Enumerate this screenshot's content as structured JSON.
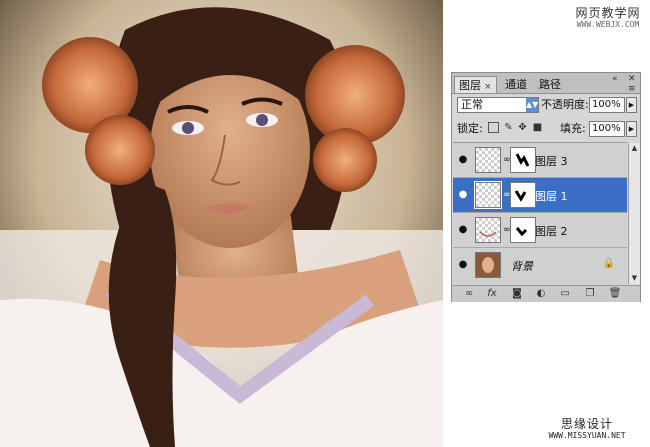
{
  "watermark_top": {
    "cn": "网页教学网",
    "url": "WWW.WEBJX.COM"
  },
  "watermark_bottom": {
    "cn": "思缘设计",
    "url": "WWW.MISSYUAN.NET"
  },
  "panel": {
    "tabs": [
      {
        "label": "图层",
        "active": true,
        "close": "×"
      },
      {
        "label": "通道",
        "active": false
      },
      {
        "label": "路径",
        "active": false
      }
    ],
    "blend_mode": "正常",
    "opacity_label": "不透明度:",
    "opacity_value": "100%",
    "lock_label": "锁定:",
    "fill_label": "填充:",
    "fill_value": "100%",
    "layers": [
      {
        "name": "图层 3",
        "selected": false
      },
      {
        "name": "图层 1",
        "selected": true
      },
      {
        "name": "图层 2",
        "selected": false
      },
      {
        "name": "背景",
        "selected": false,
        "locked": true
      }
    ]
  },
  "colors": {
    "selected_row": "#3b6fc6",
    "panel_bg": "#d6d6d6"
  }
}
